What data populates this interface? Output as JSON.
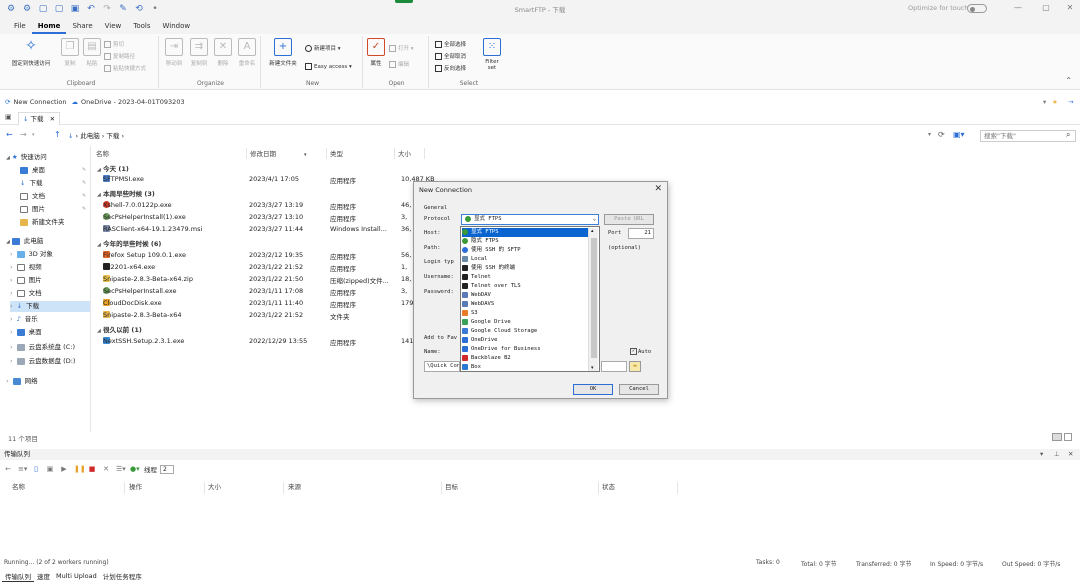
{
  "app": {
    "title": "SmartFTP - 下载",
    "optimize_touch": "Optimize for touch"
  },
  "menu": [
    "File",
    "Home",
    "Share",
    "View",
    "Tools",
    "Window"
  ],
  "ribbon": {
    "clipboard": {
      "label": "Clipboard",
      "pin": "固定到快速访问",
      "copy": "复制",
      "paste": "粘贴",
      "cut": "剪切",
      "copy_path": "复制路径",
      "paste_shortcut": "粘贴快捷方式"
    },
    "organize": {
      "label": "Organize",
      "move_to": "移动到",
      "copy_to": "复制到",
      "delete": "删除",
      "rename": "重命名"
    },
    "new": {
      "label": "New",
      "new_folder": "新建文件夹",
      "new_item": "新建项目",
      "easy_access": "Easy access"
    },
    "open": {
      "label": "Open",
      "properties": "属性",
      "open": "打开",
      "edit": "编辑"
    },
    "select": {
      "label": "Select",
      "select_all": "全部选择",
      "select_none": "全部取消",
      "invert": "反向选择",
      "filter": "Filter",
      "filter2": "set"
    }
  },
  "connbar": {
    "new_connection": "New Connection",
    "session": "OneDrive - 2023-04-01T093203"
  },
  "tab": {
    "label": "下载"
  },
  "address": {
    "path": [
      "此电脑",
      "下载"
    ],
    "search_placeholder": "搜索\"下载\""
  },
  "nav": [
    {
      "label": "快速访问",
      "level": 0
    },
    {
      "label": "桌面",
      "level": 1,
      "pin": true
    },
    {
      "label": "下载",
      "level": 1,
      "pin": true
    },
    {
      "label": "文档",
      "level": 1,
      "pin": true
    },
    {
      "label": "图片",
      "level": 1,
      "pin": true
    },
    {
      "label": "新建文件夹",
      "level": 1
    },
    {
      "label": "此电脑",
      "level": 0
    },
    {
      "label": "3D 对象",
      "level": 1
    },
    {
      "label": "视频",
      "level": 1
    },
    {
      "label": "图片",
      "level": 1
    },
    {
      "label": "文档",
      "level": 1
    },
    {
      "label": "下载",
      "level": 1,
      "selected": true
    },
    {
      "label": "音乐",
      "level": 1
    },
    {
      "label": "桌面",
      "level": 1
    },
    {
      "label": "云盘系统盘 (C:)",
      "level": 1
    },
    {
      "label": "云盘数据盘 (D:)",
      "level": 1
    },
    {
      "label": "网络",
      "level": 0
    }
  ],
  "columns": {
    "name": "名称",
    "date": "修改日期",
    "type": "类型",
    "size": "大小"
  },
  "groups": [
    {
      "title": "今天 (1)",
      "files": [
        {
          "name": "SFTPMSI.exe",
          "date": "2023/4/1 17:05",
          "type": "应用程序",
          "size": "10,487 KB"
        }
      ]
    },
    {
      "title": "本周早些时候 (3)",
      "files": [
        {
          "name": "Xshell-7.0.0122p.exe",
          "date": "2023/3/27 13:19",
          "type": "应用程序",
          "size": "46,"
        },
        {
          "name": "SecPsHelperInstall(1).exe",
          "date": "2023/3/27 13:10",
          "type": "应用程序",
          "size": "3,"
        },
        {
          "name": "RASClient-x64-19.1.23479.msi",
          "date": "2023/3/27 11:44",
          "type": "Windows Install...",
          "size": "36,"
        }
      ]
    },
    {
      "title": "今年的早些时候 (6)",
      "files": [
        {
          "name": "Firefox Setup 109.0.1.exe",
          "date": "2023/2/12 19:35",
          "type": "应用程序",
          "size": "56,"
        },
        {
          "name": "7z2201-x64.exe",
          "date": "2023/1/22 21:52",
          "type": "应用程序",
          "size": "1,"
        },
        {
          "name": "Snipaste-2.8.3-Beta-x64.zip",
          "date": "2023/1/22 21:50",
          "type": "压缩(zipped)文件...",
          "size": "18,"
        },
        {
          "name": "SecPsHelperInstall.exe",
          "date": "2023/1/11 17:08",
          "type": "应用程序",
          "size": "3,"
        },
        {
          "name": "CloudDocDisk.exe",
          "date": "2023/1/11 11:40",
          "type": "应用程序",
          "size": "179,"
        },
        {
          "name": "Snipaste-2.8.3-Beta-x64",
          "date": "2023/1/22 21:52",
          "type": "文件夹",
          "size": ""
        }
      ]
    },
    {
      "title": "很久以前 (1)",
      "files": [
        {
          "name": "NextSSH.Setup.2.3.1.exe",
          "date": "2022/12/29 13:55",
          "type": "应用程序",
          "size": "141,"
        }
      ]
    }
  ],
  "item_count": "11 个项目",
  "queue": {
    "title": "传输队列",
    "workers_label": "线程",
    "workers_value": "2",
    "columns": [
      "名称",
      "操作",
      "大小",
      "来源",
      "目标",
      "状态"
    ]
  },
  "status": {
    "running": "Running... (2 of 2 workers running)",
    "tasks": "Tasks: 0",
    "total": "Total: 0 字节",
    "transferred": "Transferred: 0 字节",
    "in_speed": "In Speed: 0 字节/s",
    "out_speed": "Out Speed: 0 字节/s"
  },
  "bottom_tabs": [
    "传输队列",
    "速度",
    "Multi Upload",
    "计划任务程序"
  ],
  "dialog": {
    "title": "New Connection",
    "general": "General",
    "protocol_label": "Protocol",
    "protocol_value": "显式 FTPS",
    "paste_url": "Paste URL",
    "host_label": "Host:",
    "port_label": "Port",
    "port_value": "21",
    "path_label": "Path:",
    "optional": "(optional)",
    "login_label": "Login typ",
    "username_label": "Username:",
    "password_label": "Password:",
    "add_to": "Add to Fav",
    "name_label": "Name:",
    "name_value": "\\Quick Con",
    "auto_label": "Auto",
    "ok": "OK",
    "cancel": "Cancel",
    "options": [
      "显式 FTPS",
      "隐式 FTPS",
      "使用 SSH 的 SFTP",
      "Local",
      "使用 SSH 的终端",
      "Telnet",
      "Telnet over TLS",
      "WebDAV",
      "WebDAVS",
      "S3",
      "Google Drive",
      "Google Cloud Storage",
      "OneDrive",
      "OneDrive for Business",
      "Backblaze B2",
      "Box"
    ]
  },
  "colors": {
    "accent": "#2b6fd6",
    "selection": "#0a64d0",
    "folder": "#e8b64a",
    "nav_selected": "#cde3f7"
  }
}
